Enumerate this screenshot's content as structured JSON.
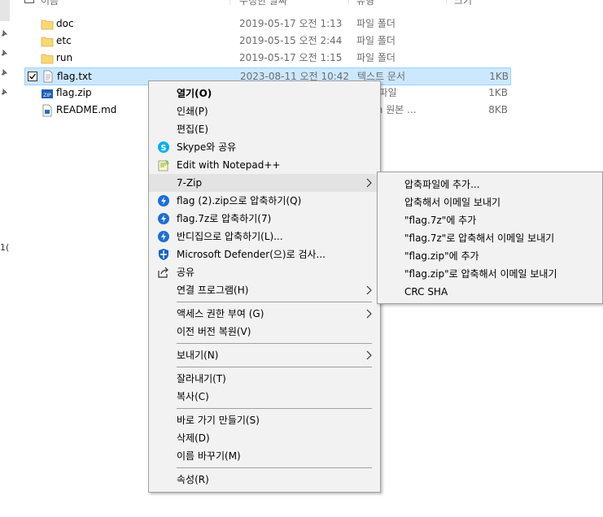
{
  "header": {
    "name": "이름",
    "date": "수정한 날짜",
    "type": "유형",
    "size": "크기"
  },
  "files": [
    {
      "name": "doc",
      "date": "2019-05-17 오전 1:13",
      "type": "파일 폴더",
      "size": "",
      "icon": "folder-icon"
    },
    {
      "name": "etc",
      "date": "2019-05-15 오전 2:44",
      "type": "파일 폴더",
      "size": "",
      "icon": "folder-icon"
    },
    {
      "name": "run",
      "date": "2019-05-17 오전 1:15",
      "type": "파일 폴더",
      "size": "",
      "icon": "folder-icon"
    },
    {
      "name": "flag.txt",
      "date": "2023-08-11 오전 10:42",
      "type": "텍스트 문서",
      "size": "1KB",
      "icon": "text-file-icon"
    },
    {
      "name": "flag.zip",
      "date": "",
      "type": "ZIP) 파일",
      "size": "1KB",
      "icon": "zip-file-icon"
    },
    {
      "name": "README.md",
      "date": "",
      "type": "down 원본 ...",
      "size": "8KB",
      "icon": "markdown-file-icon"
    }
  ],
  "left_edge_text": "1(",
  "context_menu": {
    "items": [
      {
        "label": "열기(O)",
        "icon": "",
        "bold": true
      },
      {
        "label": "인쇄(P)",
        "icon": ""
      },
      {
        "label": "편집(E)",
        "icon": ""
      },
      {
        "label": "Skype와 공유",
        "icon": "skype-icon"
      },
      {
        "label": "Edit with Notepad++",
        "icon": "notepad-plus-plus-icon"
      },
      {
        "label": "7-Zip",
        "icon": "",
        "submenu": true,
        "highlighted": true
      },
      {
        "label": "flag (2).zip으로 압축하기(Q)",
        "icon": "bandizip-icon"
      },
      {
        "label": "flag.7z로 압축하기(7)",
        "icon": "bandizip-icon"
      },
      {
        "label": "반디집으로 압축하기(L)...",
        "icon": "bandizip-icon"
      },
      {
        "label": "Microsoft Defender(으)로 검사...",
        "icon": "defender-icon"
      },
      {
        "label": "공유",
        "icon": "share-icon"
      },
      {
        "label": "연결 프로그램(H)",
        "icon": "",
        "submenu": true
      },
      {
        "label": "액세스 권한 부여 (G)",
        "icon": "",
        "submenu": true
      },
      {
        "label": "이전 버전 복원(V)",
        "icon": ""
      },
      {
        "label": "보내기(N)",
        "icon": "",
        "submenu": true
      },
      {
        "label": "잘라내기(T)",
        "icon": ""
      },
      {
        "label": "복사(C)",
        "icon": ""
      },
      {
        "label": "바로 가기 만들기(S)",
        "icon": ""
      },
      {
        "label": "삭제(D)",
        "icon": ""
      },
      {
        "label": "이름 바꾸기(M)",
        "icon": ""
      },
      {
        "label": "속성(R)",
        "icon": ""
      }
    ]
  },
  "sevenzip_submenu": {
    "items": [
      {
        "label": "압축파일에 추가..."
      },
      {
        "label": "압축해서 이메일 보내기"
      },
      {
        "label": "\"flag.7z\"에 추가"
      },
      {
        "label": "\"flag.7z\"로 압축해서 이메일 보내기"
      },
      {
        "label": "\"flag.zip\"에 추가"
      },
      {
        "label": "\"flag.zip\"로 압축해서 이메일 보내기"
      },
      {
        "label": "CRC SHA"
      }
    ]
  },
  "colors": {
    "selection_bg": "#cce8ff",
    "selection_border": "#99d1ff",
    "menu_bg": "#f2f2f2",
    "folder": "#f8d775"
  }
}
